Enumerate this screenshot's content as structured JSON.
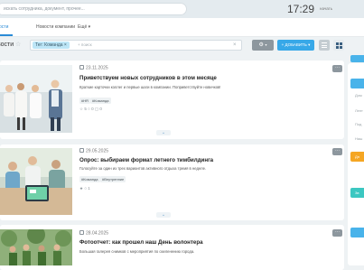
{
  "topbar": {
    "search_placeholder": "искать сотрудника, документ, прочее...",
    "time": "17:29",
    "clock_label": "начать"
  },
  "nav": {
    "tabs": [
      {
        "label": "Новости"
      },
      {
        "label": "Новости компании"
      },
      {
        "label": "Ещё"
      }
    ]
  },
  "filter": {
    "page_title": "Новости",
    "chip": "Тег: Команда",
    "search_placeholder": "+ поиск",
    "add_button": "ДОБАВИТЬ"
  },
  "posts": [
    {
      "date": "23.11.2025",
      "title": "Приветствуем новых сотрудников в этом месяце",
      "text": "Краткие карточки коллег и первые шаги в компании. Поприветствуйте новичков!",
      "tags": [
        "#HR",
        "#Команда"
      ],
      "stats": {
        "likes": "5",
        "views": "0",
        "comments": "0"
      }
    },
    {
      "date": "29.05.2025",
      "title": "Опрос: выбираем формат летнего тимбилдинга",
      "text": "Голосуйте за один из трех вариантов активного отдыха тремя в неделе.",
      "tags": [
        "#Команда",
        "#Внутренние"
      ],
      "stats": {
        "likes": "",
        "views": "1",
        "comments": ""
      }
    },
    {
      "date": "28.04.2025",
      "title": "Фотоотчет: как прошел наш День волонтера",
      "text": "Большая галерея снимков с мероприятия по озеленению города.",
      "tags": [],
      "stats": {
        "likes": "",
        "views": "",
        "comments": ""
      }
    }
  ],
  "sidebar": {
    "items": [
      {
        "label": "Дом"
      },
      {
        "label": "Лент"
      },
      {
        "label": "Под"
      },
      {
        "label": "Наш"
      },
      {
        "label": "Дн"
      },
      {
        "label": "Зв"
      }
    ]
  },
  "colors": {
    "accent": "#37a8e8",
    "sidebar_blue": "#49b3ea",
    "sidebar_orange": "#f5a623",
    "sidebar_teal": "#3cc7c1"
  }
}
